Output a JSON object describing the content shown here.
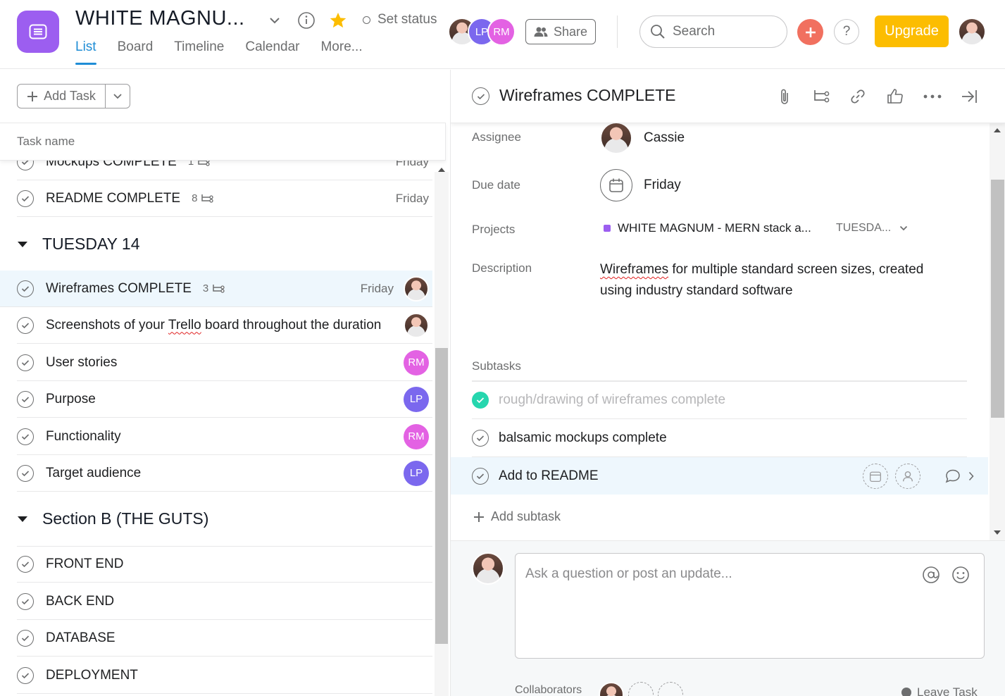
{
  "header": {
    "project_title": "WHITE MAGNU...",
    "set_status": "Set status",
    "tabs": [
      {
        "label": "List",
        "active": true
      },
      {
        "label": "Board"
      },
      {
        "label": "Timeline"
      },
      {
        "label": "Calendar"
      },
      {
        "label": "More..."
      }
    ],
    "members": [
      "LP",
      "RM"
    ],
    "share_label": "Share",
    "search_placeholder": "Search",
    "help_label": "?",
    "upgrade_label": "Upgrade",
    "colors": {
      "brand": "#9c5ef0",
      "accent": "#1f8dd6",
      "upgrade": "#fcbd01",
      "add": "#f1705f"
    }
  },
  "list": {
    "add_task_label": "Add Task",
    "column_task_name": "Task name",
    "tasks_top": [
      {
        "name": "Mockups COMPLETE",
        "subtasks": "1",
        "due": "Friday"
      },
      {
        "name": "README COMPLETE",
        "subtasks": "8",
        "due": "Friday"
      }
    ],
    "section_tuesday": "TUESDAY 14",
    "tasks_tuesday": [
      {
        "name": "Wireframes COMPLETE",
        "subtasks": "3",
        "due": "Friday",
        "assignee": "photo"
      },
      {
        "name_before": "Screenshots of your ",
        "name_typo": "Trello",
        "name_after": " board throughout the duration",
        "assignee": "photo"
      },
      {
        "name": "User stories",
        "assignee": "RM"
      },
      {
        "name": "Purpose",
        "assignee": "LP"
      },
      {
        "name": "Functionality",
        "assignee": "RM"
      },
      {
        "name": "Target audience",
        "assignee": "LP"
      }
    ],
    "section_b": "Section B (THE GUTS)",
    "tasks_b": [
      {
        "name": "FRONT END"
      },
      {
        "name": "BACK END"
      },
      {
        "name": "DATABASE"
      },
      {
        "name": "DEPLOYMENT"
      }
    ]
  },
  "detail": {
    "title": "Wireframes COMPLETE",
    "assignee_label": "Assignee",
    "assignee_name": "Cassie",
    "due_label": "Due date",
    "due_value": "Friday",
    "projects_label": "Projects",
    "project_name": "WHITE MAGNUM - MERN stack a...",
    "project_section": "TUESDA...",
    "description_label": "Description",
    "description_typo": "Wireframes",
    "description_rest": " for multiple standard screen sizes, created using industry standard software",
    "subtasks_label": "Subtasks",
    "subtasks": [
      {
        "name": "rough/drawing of wireframes complete",
        "done": true
      },
      {
        "name": "balsamic mockups complete",
        "done": false
      },
      {
        "name": "Add to README",
        "done": false
      }
    ],
    "add_subtask_label": "Add subtask",
    "comment_placeholder": "Ask a question or post an update...",
    "collaborators_label": "Collaborators",
    "leave_task_label": "Leave Task"
  }
}
